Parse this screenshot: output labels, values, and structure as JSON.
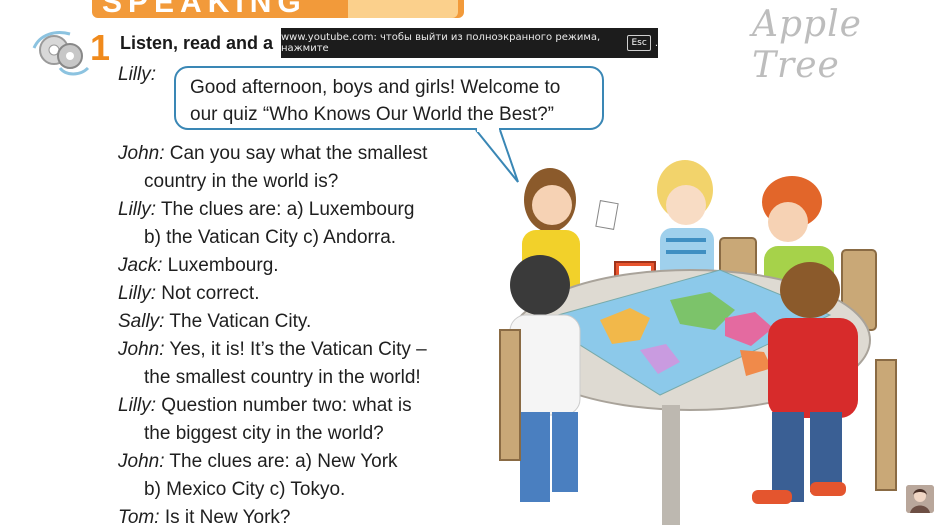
{
  "header": {
    "section_word": "SPEAKING",
    "exercise_number": "1",
    "exercise_title": "Listen, read and a"
  },
  "overlay": {
    "text_before": "www.youtube.com: чтобы выйти из полноэкранного режима, нажмите",
    "key": "Esc",
    "text_after": "."
  },
  "watermark": "Apple Tree",
  "bubble": {
    "speaker": "Lilly:",
    "line1": "Good afternoon, boys and girls! Welcome to",
    "line2": "our quiz “Who Knows Our World the Best?”"
  },
  "dialogue": [
    {
      "speaker": "John:",
      "text": "Can you say what the smallest",
      "cont": "country in the world is?"
    },
    {
      "speaker": "Lilly:",
      "text": "The clues are: a) Luxembourg",
      "cont": "b) the Vatican City  c) Andorra."
    },
    {
      "speaker": "Jack:",
      "text": "Luxembourg.",
      "cont": ""
    },
    {
      "speaker": "Lilly:",
      "text": "Not correct.",
      "cont": ""
    },
    {
      "speaker": "Sally:",
      "text": "The Vatican City.",
      "cont": ""
    },
    {
      "speaker": "John:",
      "text": "Yes, it is! It’s the Vatican City –",
      "cont": "the smallest country in the world!"
    },
    {
      "speaker": "Lilly:",
      "text": "Question number two: what is",
      "cont": "the biggest city in the world?"
    },
    {
      "speaker": "John:",
      "text": "The clues are: a) New York",
      "cont": "b) Mexico City  c) Tokyo."
    },
    {
      "speaker": "Tom:",
      "text": "Is it New York?",
      "cont": ""
    }
  ],
  "colors": {
    "banner": "#f29a3a",
    "number": "#f08a1c",
    "bubble_border": "#3a87b5"
  }
}
